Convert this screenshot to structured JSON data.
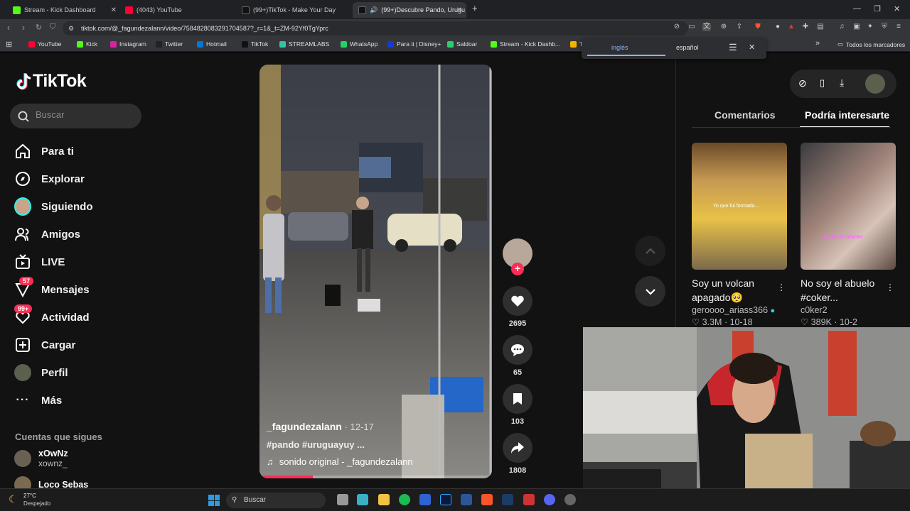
{
  "tabs": [
    {
      "title": "Stream - Kick Dashboard",
      "color": "#53fc18"
    },
    {
      "title": "(4043) YouTube",
      "color": "#ff0033"
    },
    {
      "title": "(99+)TikTok - Make Your Day",
      "color": "#ffffff"
    },
    {
      "title": "(99+)Descubre Pando, Urugu",
      "color": "#ffffff"
    }
  ],
  "address": {
    "url": "tiktok.com/@_fagundezalann/video/7584828083291704587?_r=1&_t=ZM-92Yf0TgYprc"
  },
  "bookmarks": [
    {
      "label": "YouTube",
      "color": "#ff0033"
    },
    {
      "label": "Kick",
      "color": "#53fc18"
    },
    {
      "label": "Instagram",
      "color": "#d6249f"
    },
    {
      "label": "Twitter",
      "color": "#222222"
    },
    {
      "label": "Hotmail",
      "color": "#0078d4"
    },
    {
      "label": "TikTok",
      "color": "#111111"
    },
    {
      "label": "STREAMLABS",
      "color": "#31c3a2"
    },
    {
      "label": "WhatsApp",
      "color": "#25d366"
    },
    {
      "label": "Para ti | Disney+",
      "color": "#113ccf"
    },
    {
      "label": "Saldoar",
      "color": "#2ecc71"
    },
    {
      "label": "Stream - Kick Dashb...",
      "color": "#53fc18"
    },
    {
      "label": "TIKTOKS - Google D...",
      "color": "#f4b400"
    }
  ],
  "bookmarks_folder": "Todos los marcadores",
  "translate": {
    "lang_a": "inglés",
    "lang_b": "español"
  },
  "tiktok": {
    "logo": "TikTok",
    "search_placeholder": "Buscar",
    "nav": [
      {
        "label": "Para ti",
        "icon": "home-icon"
      },
      {
        "label": "Explorar",
        "icon": "compass-icon"
      },
      {
        "label": "Siguiendo",
        "icon": "avatar-icon"
      },
      {
        "label": "Amigos",
        "icon": "friends-icon"
      },
      {
        "label": "LIVE",
        "icon": "live-icon"
      },
      {
        "label": "Mensajes",
        "icon": "inbox-icon",
        "badge": "57"
      },
      {
        "label": "Actividad",
        "icon": "heart-icon",
        "badge": "99+"
      },
      {
        "label": "Cargar",
        "icon": "plus-icon"
      },
      {
        "label": "Perfil",
        "icon": "profile-icon"
      },
      {
        "label": "Más",
        "icon": "more-icon"
      }
    ],
    "following_title": "Cuentas que sigues",
    "following": [
      {
        "name": "xOwNz",
        "handle": "xownz_"
      },
      {
        "name": "Loco Sebas",
        "handle": ""
      }
    ],
    "video": {
      "author": "_fagundezalann",
      "date": "· 12-17",
      "hashtags": "#pando #uruguayuy ...",
      "sound": "sonido original - _fagundezalann",
      "progress": 0.23
    },
    "actions": {
      "likes": "2695",
      "comments": "65",
      "saves": "103",
      "shares": "1808"
    },
    "right": {
      "tab_comments": "Comentarios",
      "tab_suggested": "Podría interesarte",
      "cards": [
        {
          "title": "Soy un volcan apagado🥺",
          "author": "geroooo_ariass366",
          "stats": "♡ 3.3M · 10-18",
          "overlay": "Yo que fui formada..."
        },
        {
          "title": "No soy el abuelo #coker...",
          "author": "c0ker2",
          "stats": "♡ 389K · 10-2",
          "overlay": "tenia el mismo"
        }
      ]
    }
  },
  "taskbar": {
    "weather_temp": "27°C",
    "weather_desc": "Despejado",
    "search": "Buscar"
  }
}
